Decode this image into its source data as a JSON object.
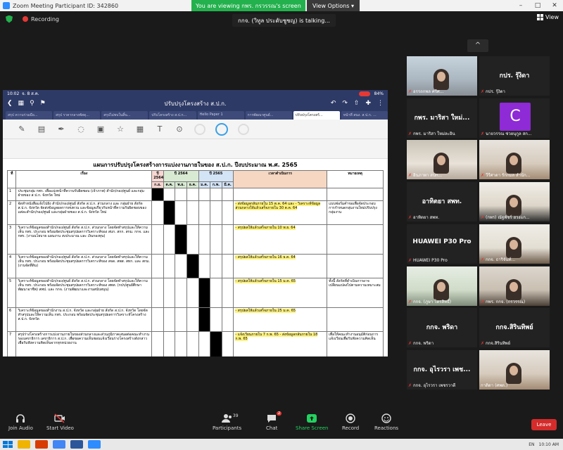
{
  "window": {
    "title": "Zoom Meeting Participant ID: 342860",
    "viewing_banner": "You are viewing กพร. กรวรรณ's screen",
    "view_options": "View Options",
    "minimize": "–",
    "maximize": "□",
    "close": "✕"
  },
  "recording": {
    "label": "Recording"
  },
  "view_button": {
    "label": "View"
  },
  "talking": "กกจ. (วิทูล ประดับชูชญ) is talking...",
  "collapse": "^",
  "tablet": {
    "time": "10:02",
    "date": "จ. 8 ส.ค.",
    "battery": "84%",
    "doc_title": "ปรับปรุงโครงสร้าง ส.ป.ก.",
    "tabs": [
      "สรุป ความร่วมมือ...",
      "สรุป ราคากลางพัสดุ...",
      "สรุปไม่พบในสิ้น...",
      "ปรับโครงสร้าง ส.ป.ก...",
      "Hello Paper 1",
      "การพัฒนาศูนย์...",
      "ปรับปรุงโครงสร้...",
      "หน้าที่ สนง. ส.ป.ก. ..."
    ],
    "tools": [
      "✎",
      "▤",
      "✒",
      "◌",
      "▣",
      "☆",
      "▦",
      "T",
      "⊙"
    ]
  },
  "document": {
    "heading": "แผนการปรับปรุงโครงสร้างการแบ่งงานภายในของ ส.ป.ก. ปีงบประมาณ พ.ศ. 2565",
    "col_no": "ที่",
    "col_subject": "เรื่อง",
    "year_a": "ปี 2564",
    "year_b": "ปี 2564",
    "year_c": "ปี 2565",
    "col_timeframe": "เวลาดำเนินการ",
    "col_remark": "หมายเหตุ",
    "months": [
      "ก.ย.",
      "ต.ค.",
      "พ.ย.",
      "ธ.ค.",
      "ม.ค.",
      "ก.พ.",
      "มี.ค."
    ],
    "rows": [
      {
        "no": "1",
        "subject": "ประชุมกลุ่ม กพร. เพื่อแบ่งหน้าที่ความรับผิดชอบ (เจ้าภาพ) สำนัก/กอง/ศูนย์ และกลุ่มฝ่ายของ ส.ป.ก. จังหวัด ใหม่",
        "time": "",
        "remark": "",
        "bar": 0
      },
      {
        "no": "2",
        "subject": "จัดทำหนังสือแจ้งไปยัง สำนัก/กอง/ศูนย์ สังกัด ส.ป.ก. ส่วนกลาง และ กลุ่มฝ่าย สังกัด ส.ป.ก. จังหวัด จัดส่งข้อมูลผลการทบทวน และข้อมูลเกี่ยวกับหน้าที่ความรับผิดชอบของแต่ละสำนัก/กอง/ศูนย์ และกลุ่มฝ่ายของ ส.ป.ก. จังหวัด ใหม่",
        "time": "- ส่งข้อมูลกลับภายใน 15 ต.ค. 64 และ - วิเคราะห์ข้อมูลส่วนกลางให้แล้วเสร็จภายใน 30 ต.ค. 64",
        "remark": "แบบฟอร์มคำขอเพื่อจัดประกอบการกำหนดกลุ่มงานใหม่ปรับปรุงกลุ่มงาน",
        "bar": 1
      },
      {
        "no": "3",
        "subject": "วิเคราะห์ข้อมูลของสำนัก/กอง/ศูนย์ สังกัด ส.ป.ก. ส่วนกลาง โดยจัดทำสรุปและให้ความเห็น กพร. ประกอบ พร้อมจัดประชุมสรุปผลการวิเคราะห์ของ สบก. สกก. สกม. กกจ. และ กพร. (งานนโยบาย แผนงาน งบประมาณ และ เงินกองทุน)",
        "time": "- สรุปผลให้แล้วเสร็จภายใน 10 พ.ย. 64",
        "remark": "",
        "bar": 2
      },
      {
        "no": "4",
        "subject": "วิเคราะห์ข้อมูลของสำนัก/กอง/ศูนย์ สังกัด ส.ป.ก. ส่วนกลาง โดยจัดทำสรุปและให้ความเห็น กพร. ประกอบ พร้อมจัดประชุมสรุปผลการวิเคราะห์ของ สจด. สพส. สทก. และ สกม. (งานจัดที่ดิน)",
        "time": "- สรุปผลให้แล้วเสร็จภายใน 16 ธ.ค. 64",
        "remark": "",
        "bar": 3
      },
      {
        "no": "5",
        "subject": "วิเคราะห์ข้อมูลของสำนัก/กอง/ศูนย์ สังกัด ส.ป.ก. ส่วนกลาง โดยจัดทำสรุปและให้ความเห็น กพร. ประกอบ พร้อมจัดประชุมสรุปผลการวิเคราะห์ของ สพท. (กปร/ศูนย์ศึกษาพัฒนาอาชีพ) สพป. และ กกจ. (งานพัฒนาและงานสนับสนุน)",
        "time": "- สรุปผลให้แล้วเสร็จภายใน 15 ม.ค. 65",
        "remark": "ทั้งนี้ สังกัดที่ดำเนินการอาจเปลี่ยนแปลงไปตามความเหมาะสม",
        "bar": 4
      },
      {
        "no": "6",
        "subject": "วิเคราะห์ข้อมูลของสำนักงาน ส.ป.ก. จังหวัด และกลุ่มฝ่าย สังกัด ส.ป.ก. จังหวัด โดยจัดทำสรุปและให้ความเห็น กพร. ประกอบ พร้อมจัดประชุมสรุปผลการวิเคราะห์โครงสร้าง ส.ป.ก. จังหวัด",
        "time": "- สรุปผลให้แล้วเสร็จภายใน 25 ม.ค. 65",
        "remark": "",
        "bar": 4
      },
      {
        "no": "7",
        "subject": "สรุปร่างโครงสร้างการแบ่งงานภายในของส่วนกลางและส่วนภูมิภาคเสนอต่อคณะทำงาน รองเลขาธิการ เลขาธิการ ส.ป.ก. เพื่อขอความเห็นชอบแจ้งเวียนร่างโครงสร้างดังกล่าวเพื่อรับฟังความคิดเห็นจากทุกหน่วยงาน",
        "time": "- แจ้งเวียนภายใน 7 ก.พ. 65 - ส่งข้อมูลกลับภายใน 18 ก.พ. 65",
        "remark": "เพื่อให้คณะทำงานอนุมัติก่อนการแจ้งเวียนเพื่อรับฟังความคิดเห็น",
        "bar": 5
      },
      {
        "no": "8",
        "subject": "สรุปผลและปรับปรุงร่างตามข้อเสนอแนะและจัดประชุมเสนอต่อคณะทำงาน รองเลขาธิการ เลขาธิการ",
        "time": "- แล้วเสร็จภายใน 28 ก.พ. 65",
        "remark": "",
        "bar": 6
      }
    ]
  },
  "participants": [
    {
      "name": "อรรถกพล ศรีศ...",
      "kind": "video-a",
      "big": "",
      "muted": true
    },
    {
      "name": "กปร. รุ้งิดา",
      "kind": "label",
      "big": "กปร. รุ้งิดา",
      "muted": true
    },
    {
      "name": "กพร. มาริสา ใหม่ละอิน",
      "kind": "label",
      "big": "กพร. มาริสา ใหม่...",
      "muted": true
    },
    {
      "name": "นายวรรณ ช่วยนุกูล สก...",
      "kind": "letter",
      "big": "C",
      "muted": true
    },
    {
      "name": "อินภาพา สปก...",
      "kind": "video-b",
      "big": "",
      "muted": true
    },
    {
      "name": "วีรีศาดา รักกมล สำนัก...",
      "kind": "video-c",
      "big": "",
      "muted": true
    },
    {
      "name": "อาทิตยา สพท.",
      "kind": "label",
      "big": "อาทิตยา สพท.",
      "muted": true
    },
    {
      "name": "(กพร) ณัฐพัชร์ ฮวงแก...",
      "kind": "video-d",
      "big": "",
      "muted": true
    },
    {
      "name": "HUAWEI P30 Pro",
      "kind": "label",
      "big": "HUAWEI P30 Pro",
      "muted": true
    },
    {
      "name": "กกจ. ธาริจันท์...",
      "kind": "video-e",
      "big": "",
      "muted": true
    },
    {
      "name": "กกจ. (ภูษา โตรสิทธิ์)",
      "kind": "video-f",
      "big": "",
      "muted": true
    },
    {
      "name": "กพร. กกจ. (กรวรรณ)",
      "kind": "video-g",
      "big": "",
      "muted": true
    },
    {
      "name": "กกจ. พริดา",
      "kind": "label",
      "big": "กกจ. พริดา",
      "muted": true
    },
    {
      "name": "กกจ.สิรินทิพย์",
      "kind": "label",
      "big": "กกจ.สิรินทิพย์",
      "muted": true
    },
    {
      "name": "กกจ. อุไรวรา เพชรวาดี",
      "kind": "label",
      "big": "กกจ. อุไรวรา เพช...",
      "muted": true
    },
    {
      "name": "กาติดา (ศพด.)",
      "kind": "video-c",
      "big": "",
      "muted": false
    }
  ],
  "toolbar": {
    "join_audio": "Join Audio",
    "start_video": "Start Video",
    "participants": "Participants",
    "participants_count": "39",
    "chat": "Chat",
    "chat_badge": "2",
    "share_screen": "Share Screen",
    "record": "Record",
    "reactions": "Reactions",
    "leave": "Leave"
  },
  "taskbar": {
    "lang": "EN",
    "time": "10:10 AM"
  },
  "colors": {
    "zoom_green": "#23b14d",
    "leave_red": "#d42b2b",
    "tablet_bar": "#2e3a66",
    "highlight_yellow": "#fff27a",
    "highlight_pink": "#f5c2e7"
  }
}
